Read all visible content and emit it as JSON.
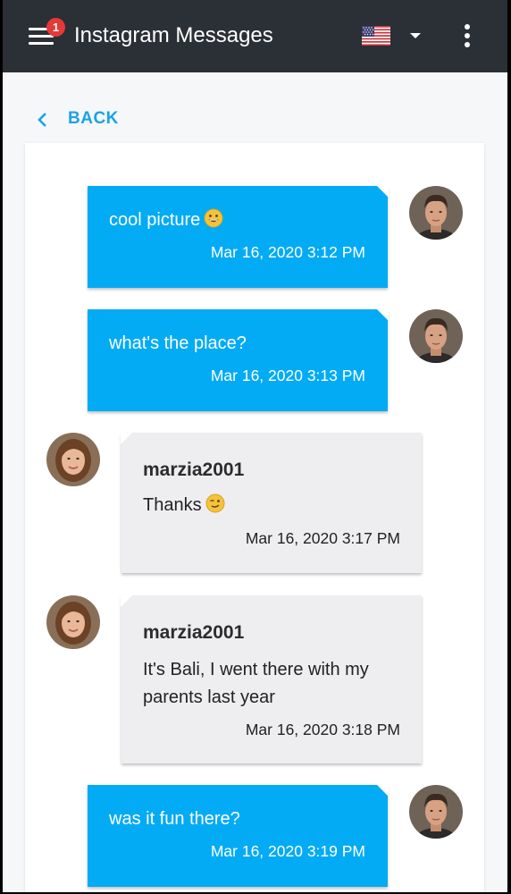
{
  "appbar": {
    "title": "Instagram Messages",
    "badge_count": "1",
    "language_flag": "us-flag-icon"
  },
  "nav": {
    "back_label": "BACK"
  },
  "colors": {
    "appbar_bg": "#2b2f36",
    "outgoing_bubble": "#03abf5",
    "incoming_bubble": "#eeeef1",
    "accent": "#1aa3e8",
    "badge": "#e53935"
  },
  "messages": [
    {
      "direction": "outgoing",
      "text": "cool picture",
      "emoji": "grinning-face",
      "time": "Mar 16, 2020 3:12 PM"
    },
    {
      "direction": "outgoing",
      "text": "what's the place?",
      "time": "Mar 16, 2020 3:13 PM"
    },
    {
      "direction": "incoming",
      "sender": "marzia2001",
      "text": "Thanks",
      "emoji": "winking-face",
      "time": "Mar 16, 2020 3:17 PM"
    },
    {
      "direction": "incoming",
      "sender": "marzia2001",
      "text_lines": [
        "It's Bali, I went there with my",
        "parents last year"
      ],
      "time": "Mar 16, 2020 3:18 PM"
    },
    {
      "direction": "outgoing",
      "text": "was it fun there?",
      "time": "Mar 16, 2020 3:19 PM"
    }
  ]
}
